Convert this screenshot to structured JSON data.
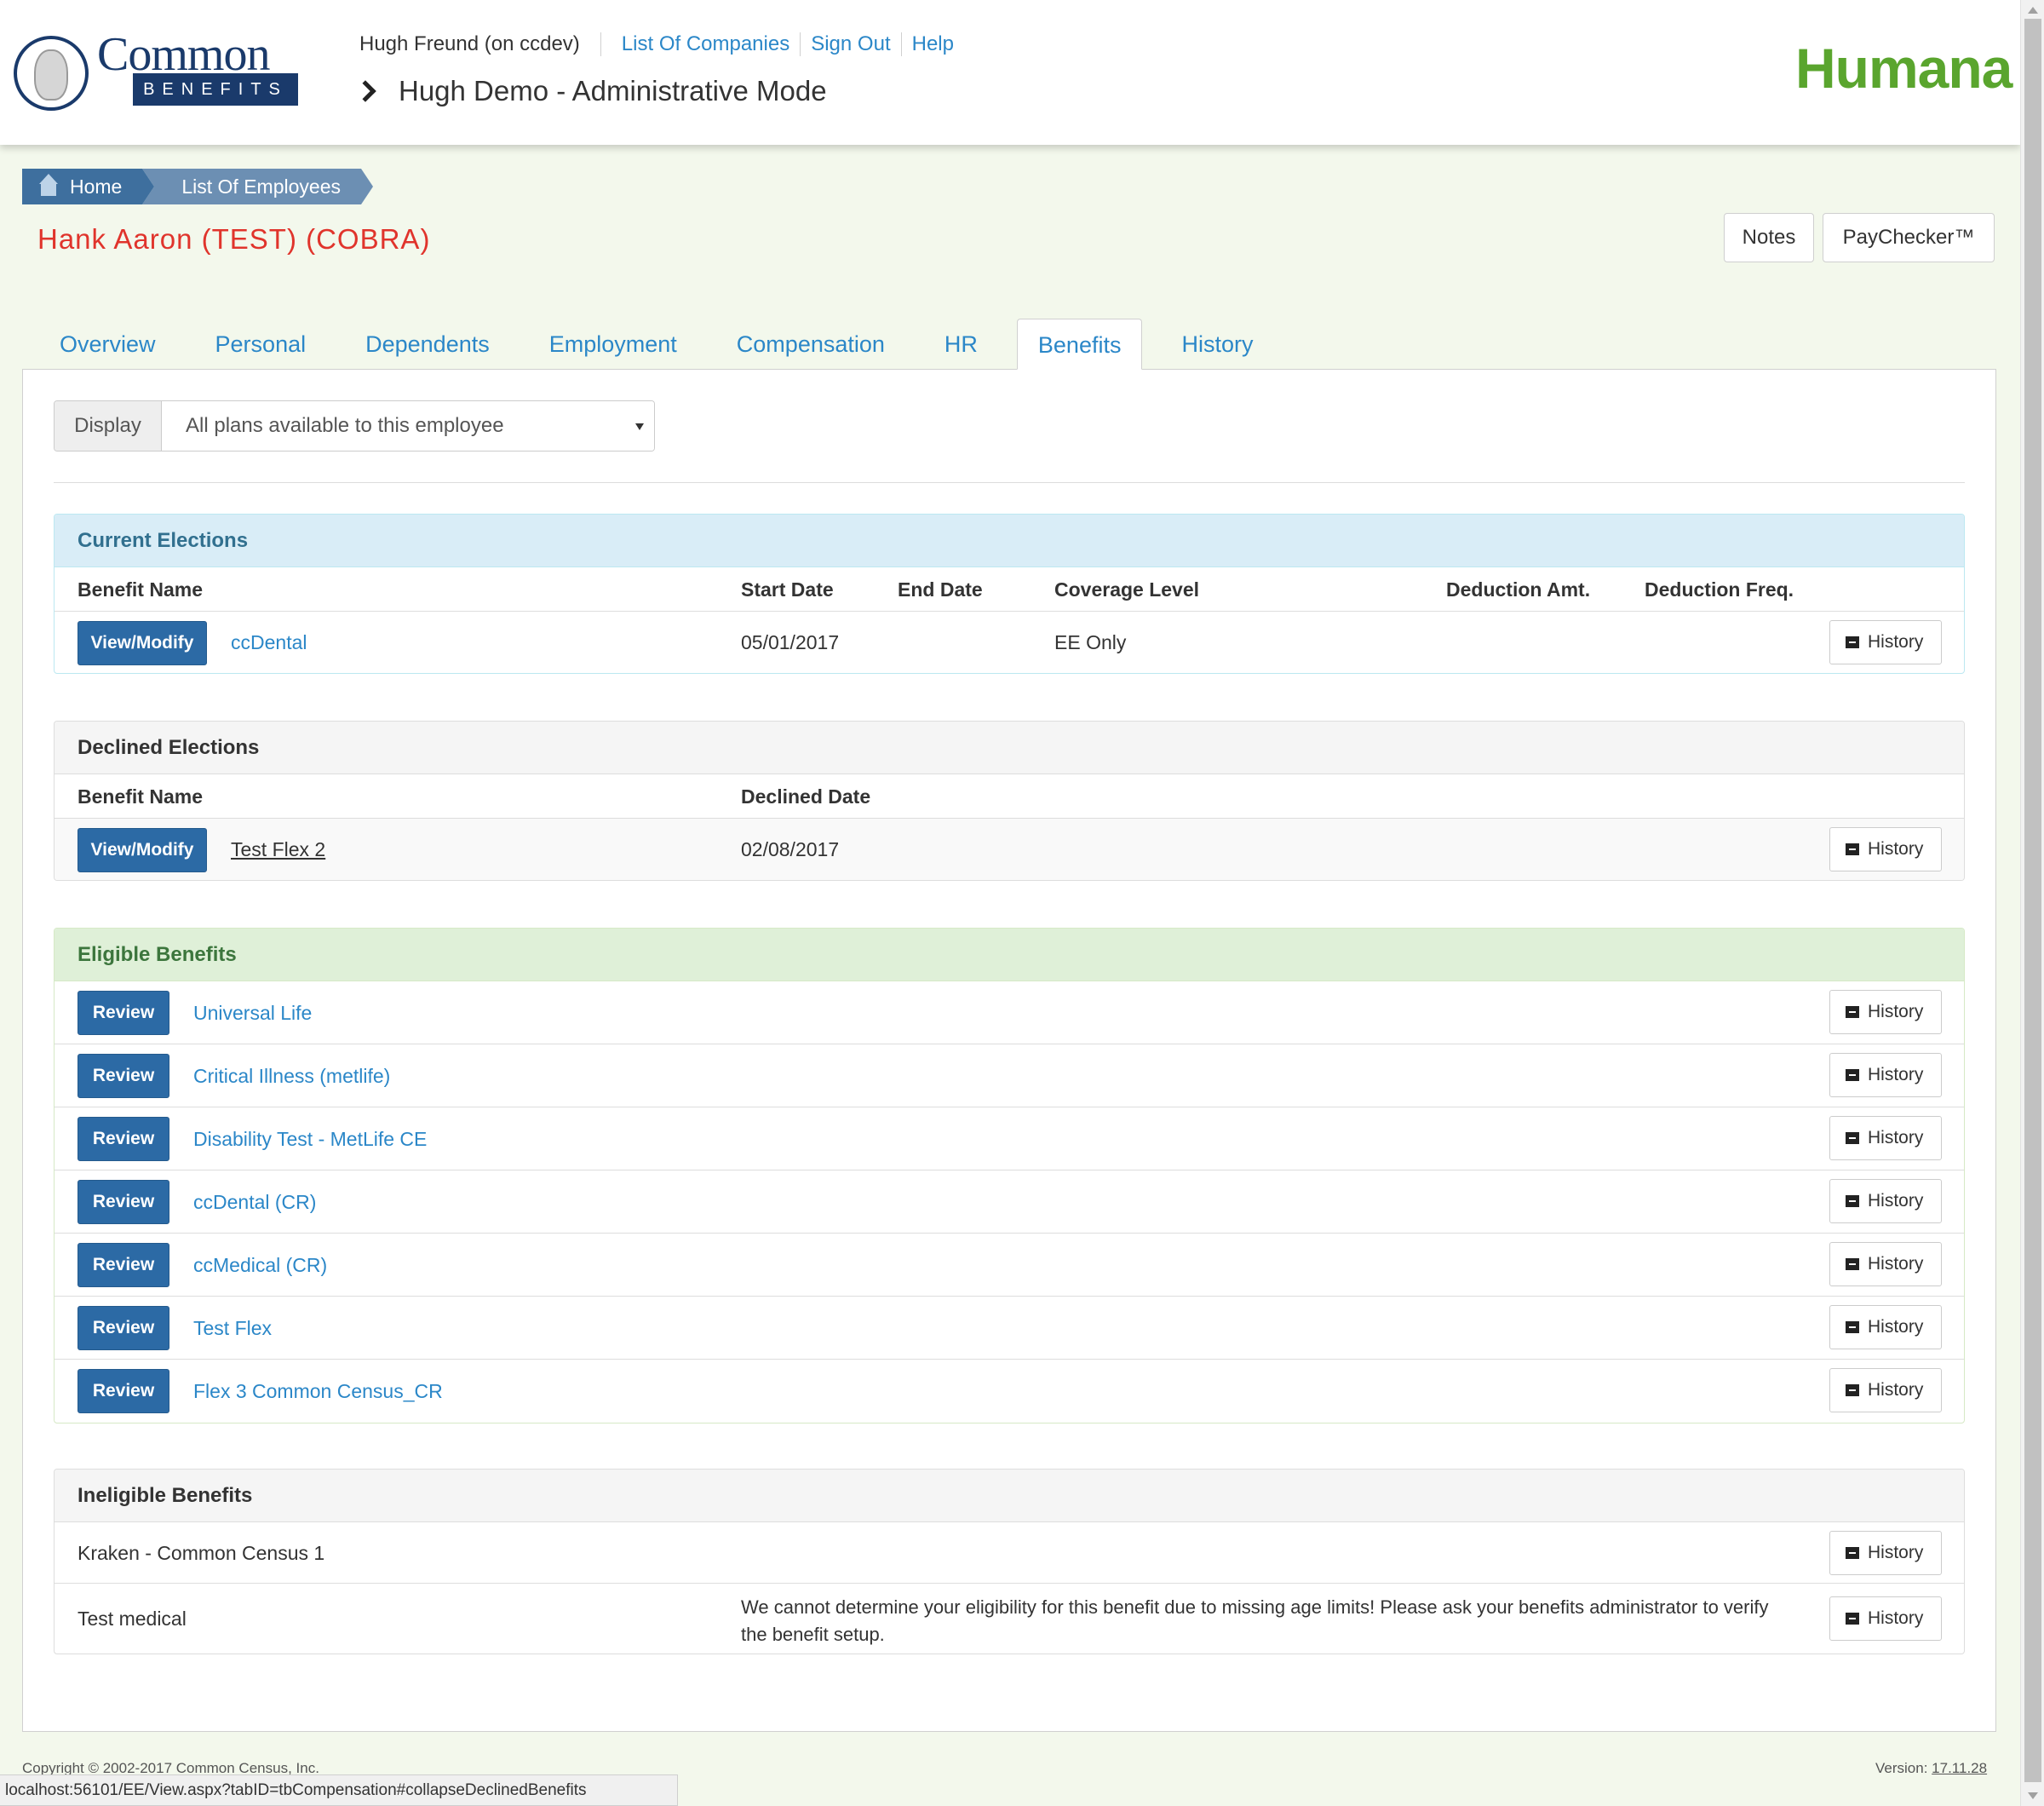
{
  "logo": {
    "word": "Common",
    "sub": "BENEFITS"
  },
  "header": {
    "user": "Hugh Freund (on ccdev)",
    "links": [
      "List Of Companies",
      "Sign Out",
      "Help"
    ],
    "mode": "Hugh Demo - Administrative Mode",
    "brand": "Humana",
    "brand_color": "#5aa52e"
  },
  "breadcrumb": [
    "Home",
    "List Of Employees"
  ],
  "employee": {
    "name": "Hank Aaron (TEST) (COBRA)",
    "name_color": "#e0342c"
  },
  "actions": {
    "notes": "Notes",
    "paychecker": "PayChecker™"
  },
  "tabs": [
    "Overview",
    "Personal",
    "Dependents",
    "Employment",
    "Compensation",
    "HR",
    "Benefits",
    "History"
  ],
  "active_tab": "Benefits",
  "display": {
    "label": "Display",
    "value": "All plans available to this employee"
  },
  "current": {
    "title": "Current Elections",
    "columns": [
      "Benefit Name",
      "Start Date",
      "End Date",
      "Coverage Level",
      "Deduction Amt.",
      "Deduction Freq."
    ],
    "rows": [
      {
        "button": "View/Modify",
        "name": "ccDental",
        "start": "05/01/2017",
        "end": "",
        "coverage": "EE Only",
        "amt": "",
        "freq": "",
        "history": "History"
      }
    ]
  },
  "declined": {
    "title": "Declined Elections",
    "columns": [
      "Benefit Name",
      "Declined Date"
    ],
    "rows": [
      {
        "button": "View/Modify",
        "name": "Test Flex 2",
        "date": "02/08/2017",
        "history": "History"
      }
    ]
  },
  "eligible": {
    "title": "Eligible Benefits",
    "button": "Review",
    "history": "History",
    "rows": [
      "Universal Life",
      "Critical Illness (metlife)",
      "Disability Test - MetLife CE",
      "ccDental (CR)",
      "ccMedical (CR)",
      "Test Flex",
      "Flex 3 Common Census_CR"
    ]
  },
  "ineligible": {
    "title": "Ineligible Benefits",
    "history": "History",
    "rows": [
      {
        "name": "Kraken - Common Census 1",
        "note": ""
      },
      {
        "name": "Test medical",
        "note": "We cannot determine your eligibility for this benefit due to missing age limits! Please ask your benefits administrator to verify the benefit setup."
      }
    ]
  },
  "footer": {
    "copyright": "Copyright © 2002-2017 Common Census, Inc.",
    "version_label": "Version:",
    "version": "17.11.28",
    "status_url": "localhost:56101/EE/View.aspx?tabID=tbCompensation#collapseDeclinedBenefits"
  }
}
